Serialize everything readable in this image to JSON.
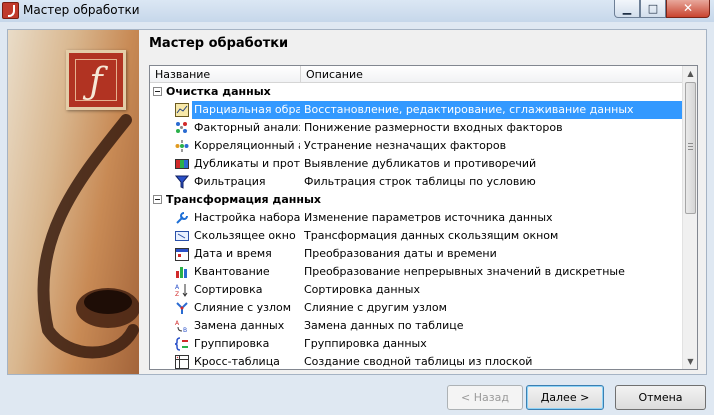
{
  "window": {
    "title": "Мастер обработки"
  },
  "dialog": {
    "heading": "Мастер обработки"
  },
  "list": {
    "columns": [
      "Название",
      "Описание"
    ],
    "rows": [
      {
        "type": "group",
        "label": "Очистка данных"
      },
      {
        "type": "item",
        "icon": "partial-processing-icon",
        "name": "Парциальная обра...",
        "desc": "Восстановление, редактирование, сглаживание данных",
        "selected": true
      },
      {
        "type": "item",
        "icon": "factor-analysis-icon",
        "name": "Факторный анализ",
        "desc": "Понижение размерности входных факторов"
      },
      {
        "type": "item",
        "icon": "correlation-analysis-icon",
        "name": "Корреляционный а...",
        "desc": "Устранение незначащих факторов"
      },
      {
        "type": "item",
        "icon": "duplicates-icon",
        "name": "Дубликаты и прот...",
        "desc": "Выявление дубликатов и противоречий"
      },
      {
        "type": "item",
        "icon": "filter-icon",
        "name": "Фильтрация",
        "desc": "Фильтрация строк таблицы по условию"
      },
      {
        "type": "group",
        "label": "Трансформация данных"
      },
      {
        "type": "item",
        "icon": "wrench-icon",
        "name": "Настройка набора ...",
        "desc": "Изменение параметров источника данных"
      },
      {
        "type": "item",
        "icon": "sliding-window-icon",
        "name": "Скользящее окно",
        "desc": "Трансформация данных скользящим окном"
      },
      {
        "type": "item",
        "icon": "calendar-icon",
        "name": "Дата и время",
        "desc": "Преобразования даты и времени"
      },
      {
        "type": "item",
        "icon": "quantization-icon",
        "name": "Квантование",
        "desc": "Преобразование непрерывных значений в дискретные"
      },
      {
        "type": "item",
        "icon": "sort-icon",
        "name": "Сортировка",
        "desc": "Сортировка данных"
      },
      {
        "type": "item",
        "icon": "merge-icon",
        "name": "Слияние с узлом",
        "desc": "Слияние с другим узлом"
      },
      {
        "type": "item",
        "icon": "replace-icon",
        "name": "Замена данных",
        "desc": "Замена данных по таблице"
      },
      {
        "type": "item",
        "icon": "group-icon",
        "name": "Группировка",
        "desc": "Группировка данных"
      },
      {
        "type": "item",
        "icon": "crosstab-icon",
        "name": "Кросс-таблица",
        "desc": "Создание сводной таблицы из плоской"
      }
    ]
  },
  "buttons": {
    "back": "< Назад",
    "next": "Далее >",
    "cancel": "Отмена"
  },
  "colors": {
    "selection": "#3399ff",
    "logo": "#b13322"
  }
}
